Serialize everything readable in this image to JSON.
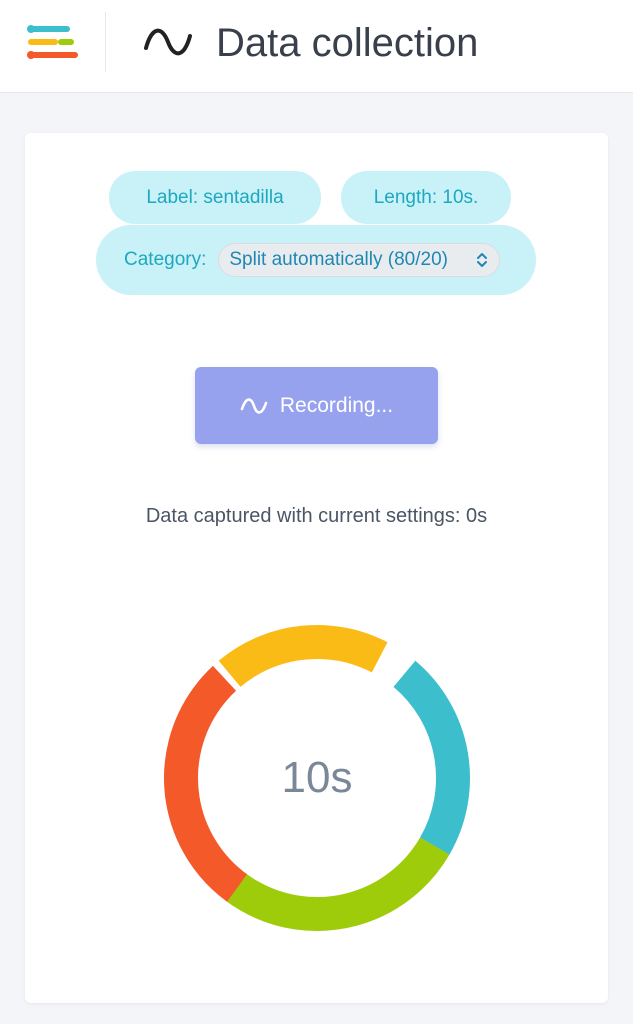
{
  "header": {
    "title": "Data collection",
    "menu_icon": "menu-bars-icon",
    "title_icon": "sine-wave-icon"
  },
  "settings": {
    "label": "Label: sentadilla",
    "length": "Length: 10s.",
    "category_label": "Category:",
    "category_value": "Split automatically (80/20)"
  },
  "record_button": {
    "label": "Recording...",
    "icon": "sine-wave-icon"
  },
  "captured_text": "Data captured with current settings: 0s",
  "timer": {
    "value": "10s",
    "segment_colors": [
      "#fbbb17",
      "#3dbecc",
      "#9fcc0a",
      "#f4592a"
    ]
  },
  "colors": {
    "pill_bg": "#c9f1f8",
    "pill_text": "#1ea8bf",
    "button_bg": "#97a2ee"
  }
}
